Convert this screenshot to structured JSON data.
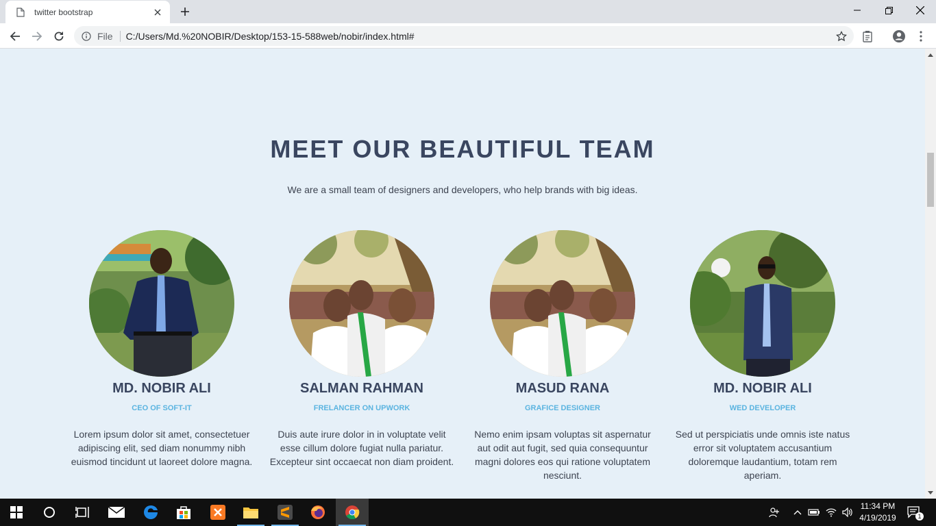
{
  "browser": {
    "tab_title": "twitter bootstrap",
    "scheme_label": "File",
    "url": "C:/Users/Md.%20NOBIR/Desktop/153-15-588web/nobir/index.html#"
  },
  "section": {
    "title": "MEET OUR BEAUTIFUL TEAM",
    "subtitle": "We are a small team of designers and developers, who help brands with big ideas."
  },
  "team": [
    {
      "name": "MD. NOBIR ALI",
      "role": "CEO OF SOFT-IT",
      "bio": "Lorem ipsum dolor sit amet, consectetuer adipiscing elit, sed diam nonummy nibh euismod tincidunt ut laoreet dolore magna.",
      "photo": "man in navy shirt and blue tie standing in park"
    },
    {
      "name": "SALMAN RAHMAN",
      "role": "FRELANCER ON UPWORK",
      "bio": "Duis aute irure dolor in in voluptate velit esse cillum dolore fugiat nulla pariatur. Excepteur sint occaecat non diam proident.",
      "photo": "group selfie of young men outdoors under tree"
    },
    {
      "name": "MASUD RANA",
      "role": "GRAFICE DESIGNER",
      "bio": "Nemo enim ipsam voluptas sit aspernatur aut odit aut fugit, sed quia consequuntur magni dolores eos qui ratione voluptatem nesciunt.",
      "photo": "group selfie of young men outdoors under tree"
    },
    {
      "name": "MD. NOBIR ALI",
      "role": "WED DEVELOPER",
      "bio": "Sed ut perspiciatis unde omnis iste natus error sit voluptatem accusantium doloremque laudantium, totam rem aperiam.",
      "photo": "man in sunglasses and tie standing in garden"
    }
  ],
  "taskbar": {
    "time": "11:34 PM",
    "date": "4/19/2019",
    "notification_count": "1"
  },
  "colors": {
    "page_bg": "#e6f0f8",
    "heading": "#3a4660",
    "role": "#5bb4e0",
    "body_text": "#3d4350"
  }
}
